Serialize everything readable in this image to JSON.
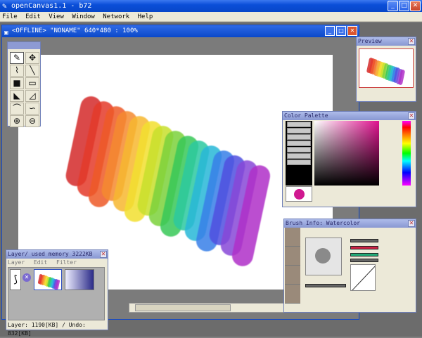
{
  "app": {
    "title": "openCanvas1.1 - b72",
    "controls": {
      "minimize": "_",
      "maximize": "□",
      "close": "✕"
    }
  },
  "menu": [
    "File",
    "Edit",
    "View",
    "Window",
    "Network",
    "Help"
  ],
  "canvas_window": {
    "title": "<OFFLINE>  \"NONAME\" 640*480 : 100%",
    "controls": {
      "minimize": "_",
      "maximize": "□",
      "close": "✕"
    }
  },
  "tool_icons": [
    "pen-icon",
    "move-icon",
    "dropper-icon",
    "line-icon",
    "fill-icon",
    "select-rect-icon",
    "lasso-fill-icon",
    "lasso-icon",
    "curve-icon",
    "curve-alt-icon",
    "zoom-in-icon",
    "zoom-out-icon"
  ],
  "preview": {
    "title": "Preview",
    "close": "✕"
  },
  "color_palette": {
    "title": "Color Palette",
    "close": "✕",
    "current_color": "#d01890"
  },
  "brush_info": {
    "title": "Brush Info: Watercolor",
    "close": "✕"
  },
  "layer": {
    "title": "Layer/ used memory 3222KB",
    "close": "✕",
    "menu": [
      "Layer",
      "Edit",
      "Filter"
    ],
    "status": "Layer: 1190[KB] / Undo: 832[KB]"
  },
  "stroke_colors": [
    "#d42a2a",
    "#e43a2a",
    "#ee5a28",
    "#f58a30",
    "#f7b830",
    "#f3e030",
    "#c8e02c",
    "#7cd23c",
    "#38c858",
    "#2cc9a0",
    "#28b8d8",
    "#3880e8",
    "#5050e0",
    "#8848d8",
    "#b030c8"
  ]
}
